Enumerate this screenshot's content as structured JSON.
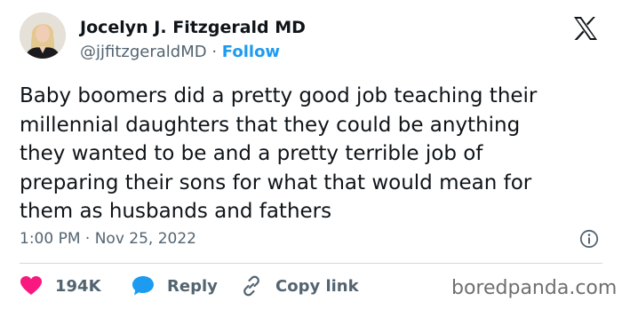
{
  "author": {
    "name": "Jocelyn J. Fitzgerald MD",
    "handle": "@jjfitzgeraldMD",
    "separator": "·",
    "follow_label": "Follow"
  },
  "tweet": {
    "lines": [
      "Baby boomers did a pretty good job teaching their",
      "millennial daughters that they could be anything",
      "they wanted to be and a pretty terrible job of",
      "preparing their sons for what that would mean for",
      "them as husbands and fathers"
    ],
    "timestamp": "1:00 PM · Nov 25, 2022"
  },
  "actions": {
    "like_count": "194K",
    "reply_label": "Reply",
    "copy_link_label": "Copy link"
  },
  "watermark": "boredpanda.com",
  "icons": {
    "x_logo": "x-logo-icon",
    "info": "info-icon",
    "heart": "heart-icon",
    "reply": "speech-bubble-icon",
    "link": "link-icon"
  },
  "colors": {
    "like": "#f91880",
    "reply": "#1d9bf0",
    "follow": "#1d9bf0",
    "secondary_text": "#536471"
  }
}
